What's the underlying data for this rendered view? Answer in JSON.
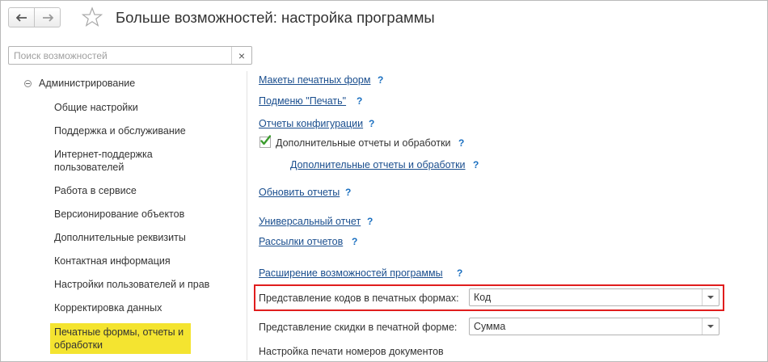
{
  "header": {
    "title": "Больше возможностей: настройка программы"
  },
  "search": {
    "placeholder": "Поиск возможностей",
    "value": "",
    "clear_glyph": "×"
  },
  "sidebar": {
    "group_label": "Администрирование",
    "items": [
      {
        "label": "Общие настройки"
      },
      {
        "label": "Поддержка и обслуживание"
      },
      {
        "label": "Интернет-поддержка пользователей"
      },
      {
        "label": "Работа в сервисе"
      },
      {
        "label": "Версионирование объектов"
      },
      {
        "label": "Дополнительные реквизиты"
      },
      {
        "label": "Контактная информация"
      },
      {
        "label": "Настройки пользователей и прав"
      },
      {
        "label": "Корректировка данных"
      },
      {
        "label": "Печатные формы, отчеты и обработки",
        "selected": true
      }
    ]
  },
  "content": {
    "help_mark": "?",
    "links": {
      "print_layouts": "Макеты печатных форм",
      "print_submenu": "Подменю \"Печать\"",
      "config_reports": "Отчеты конфигурации",
      "additional_reports_link": "Дополнительные отчеты и обработки",
      "update_reports": "Обновить отчеты",
      "universal_report": "Универсальный отчет",
      "report_mailings": "Рассылки отчетов",
      "extensions": "Расширение возможностей программы"
    },
    "additional_reports_checkbox": {
      "label": "Дополнительные отчеты и обработки",
      "checked": true
    },
    "codes_field": {
      "label": "Представление кодов в печатных формах:",
      "value": "Код"
    },
    "discount_field": {
      "label": "Представление скидки в печатной форме:",
      "value": "Сумма"
    },
    "doc_numbers_heading": "Настройка печати номеров документов"
  },
  "colors": {
    "link": "#1a4e8e",
    "help": "#1a6fc0",
    "selected_bg": "#f4e430",
    "highlight_border": "#e01d1d",
    "checkmark": "#3a9b2c"
  }
}
